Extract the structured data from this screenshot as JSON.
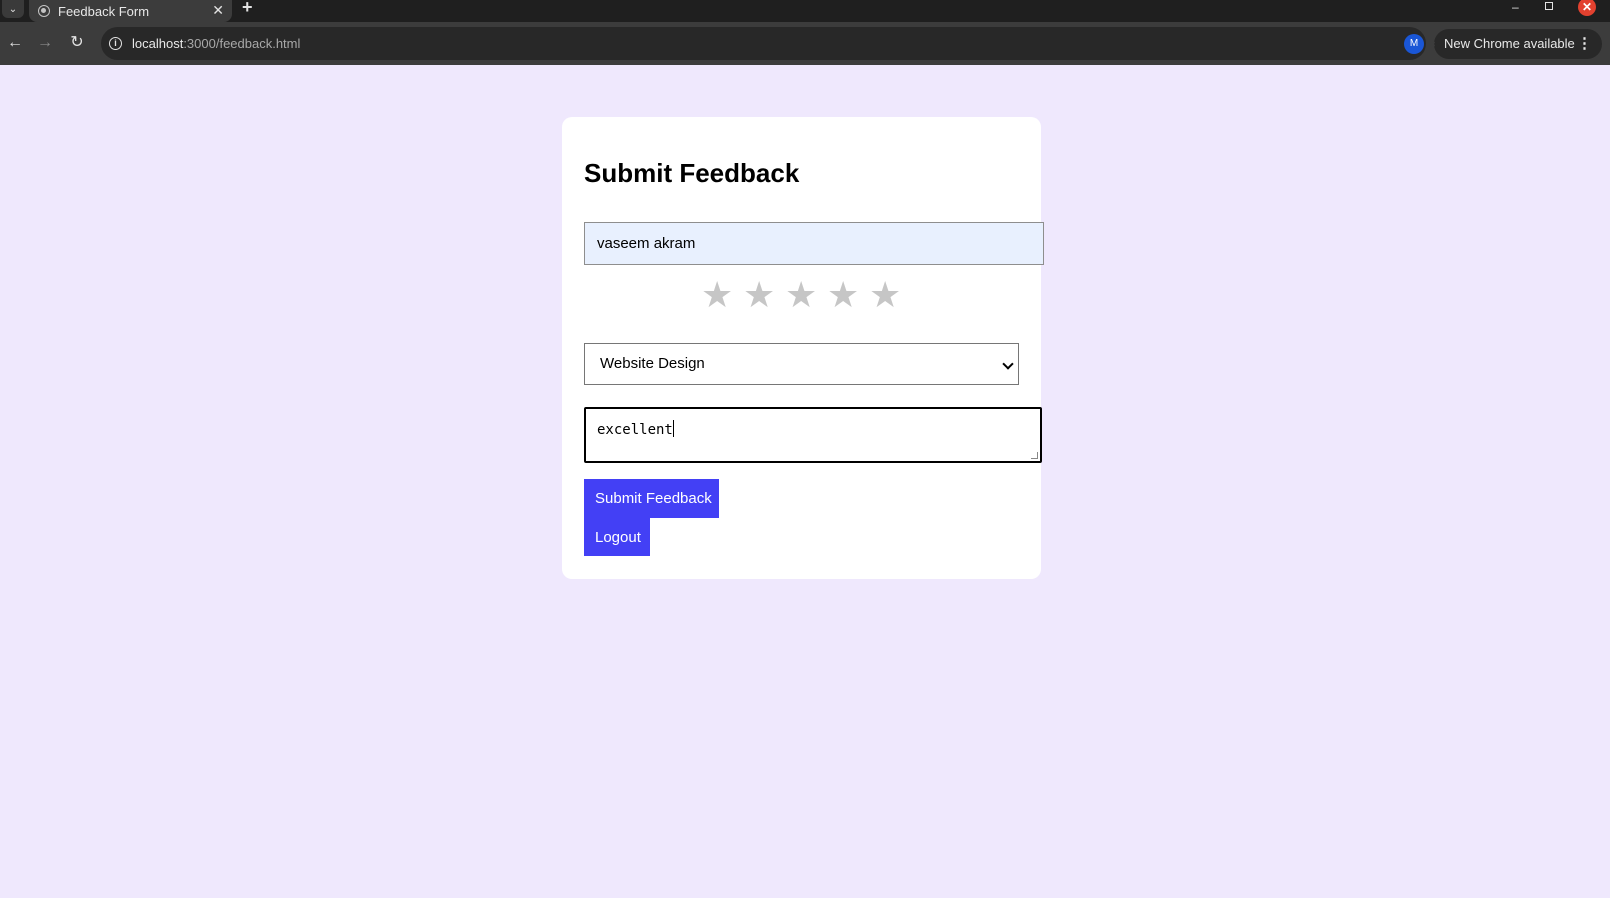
{
  "browser": {
    "tab_title": "Feedback Form",
    "tab_close": "✕",
    "new_tab": "+",
    "url_host": "localhost",
    "url_path": ":3000/feedback.html",
    "profile_initial": "M",
    "update_label": "New Chrome available",
    "window_min": "–",
    "window_close": "✕"
  },
  "form": {
    "title": "Submit Feedback",
    "name_value": "vaseem akram",
    "rating": {
      "selected": 0,
      "max": 5,
      "star_glyph": "★"
    },
    "category_value": "Website Design",
    "comment_value": "excellent",
    "submit_label": "Submit Feedback",
    "logout_label": "Logout"
  },
  "colors": {
    "page_background": "#efe8fd",
    "button": "#4340f5",
    "input_autofill": "#e8f0fe",
    "star_inactive": "#c6c6c6"
  }
}
